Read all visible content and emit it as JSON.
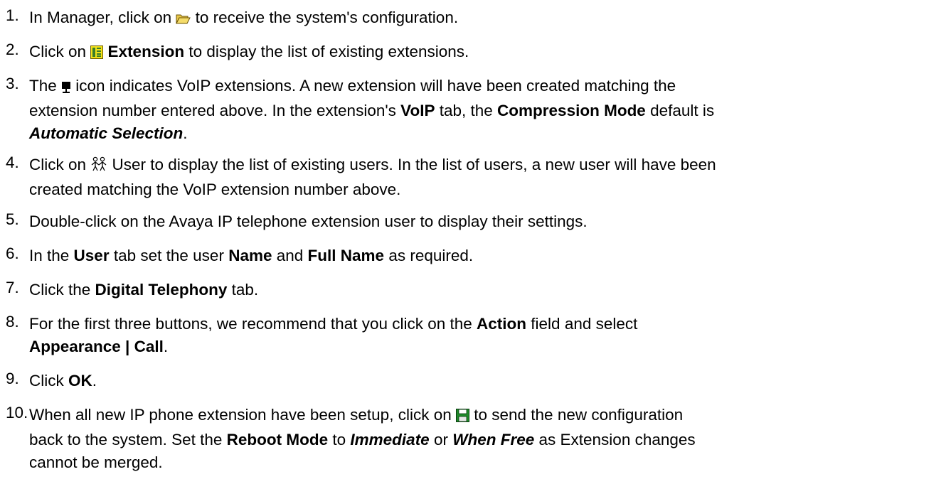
{
  "steps": [
    {
      "number": "1.",
      "segments": {
        "a": "In Manager, click on ",
        "b": " to receive the system's configuration."
      },
      "icon": "folder-open-icon"
    },
    {
      "number": "2.",
      "segments": {
        "a": "Click on ",
        "b": "Extension",
        "c": " to display the list of existing extensions."
      },
      "icon": "extension-list-icon"
    },
    {
      "number": "3.",
      "lines": [
        {
          "a": "The ",
          "b": " icon indicates VoIP extensions. A new extension will have been created matching the"
        },
        {
          "a": "extension number entered above. In the extension's ",
          "b": "VoIP",
          "c": " tab, the ",
          "d": "Compression Mode",
          "e": " default is"
        },
        {
          "a": "Automatic Selection",
          "b": "."
        }
      ],
      "icon": "voip-extension-icon"
    },
    {
      "number": "4.",
      "lines": [
        {
          "a": "Click on ",
          "b": " User to display the list of existing users. In the list of users, a new user will have been"
        },
        {
          "a": "created matching the VoIP extension number above."
        }
      ],
      "icon": "users-icon"
    },
    {
      "number": "5.",
      "segments": {
        "a": "Double-click on the Avaya IP telephone extension user to display their settings."
      }
    },
    {
      "number": "6.",
      "segments": {
        "a": "In the ",
        "b": "User",
        "c": " tab set the user ",
        "d": "Name",
        "e": " and ",
        "f": "Full Name",
        "g": " as required."
      }
    },
    {
      "number": "7.",
      "segments": {
        "a": "Click the ",
        "b": "Digital Telephony",
        "c": " tab."
      }
    },
    {
      "number": "8.",
      "lines": [
        {
          "a": "For the first three buttons, we recommend that you click on the ",
          "b": "Action",
          "c": " field and select"
        },
        {
          "a": "Appearance | Call",
          "b": "."
        }
      ]
    },
    {
      "number": "9.",
      "segments": {
        "a": "Click ",
        "b": "OK",
        "c": "."
      }
    },
    {
      "number": "10.",
      "lines": [
        {
          "a": "When all new IP phone extension have been setup, click on ",
          "b": " to send the new configuration"
        },
        {
          "a": "back to the system. Set the ",
          "b": "Reboot Mode",
          "c": " to ",
          "d": "Immediate",
          "e": " or ",
          "f": "When Free",
          "g": " as Extension changes"
        },
        {
          "a": "cannot be merged."
        }
      ],
      "icon": "save-icon"
    }
  ]
}
